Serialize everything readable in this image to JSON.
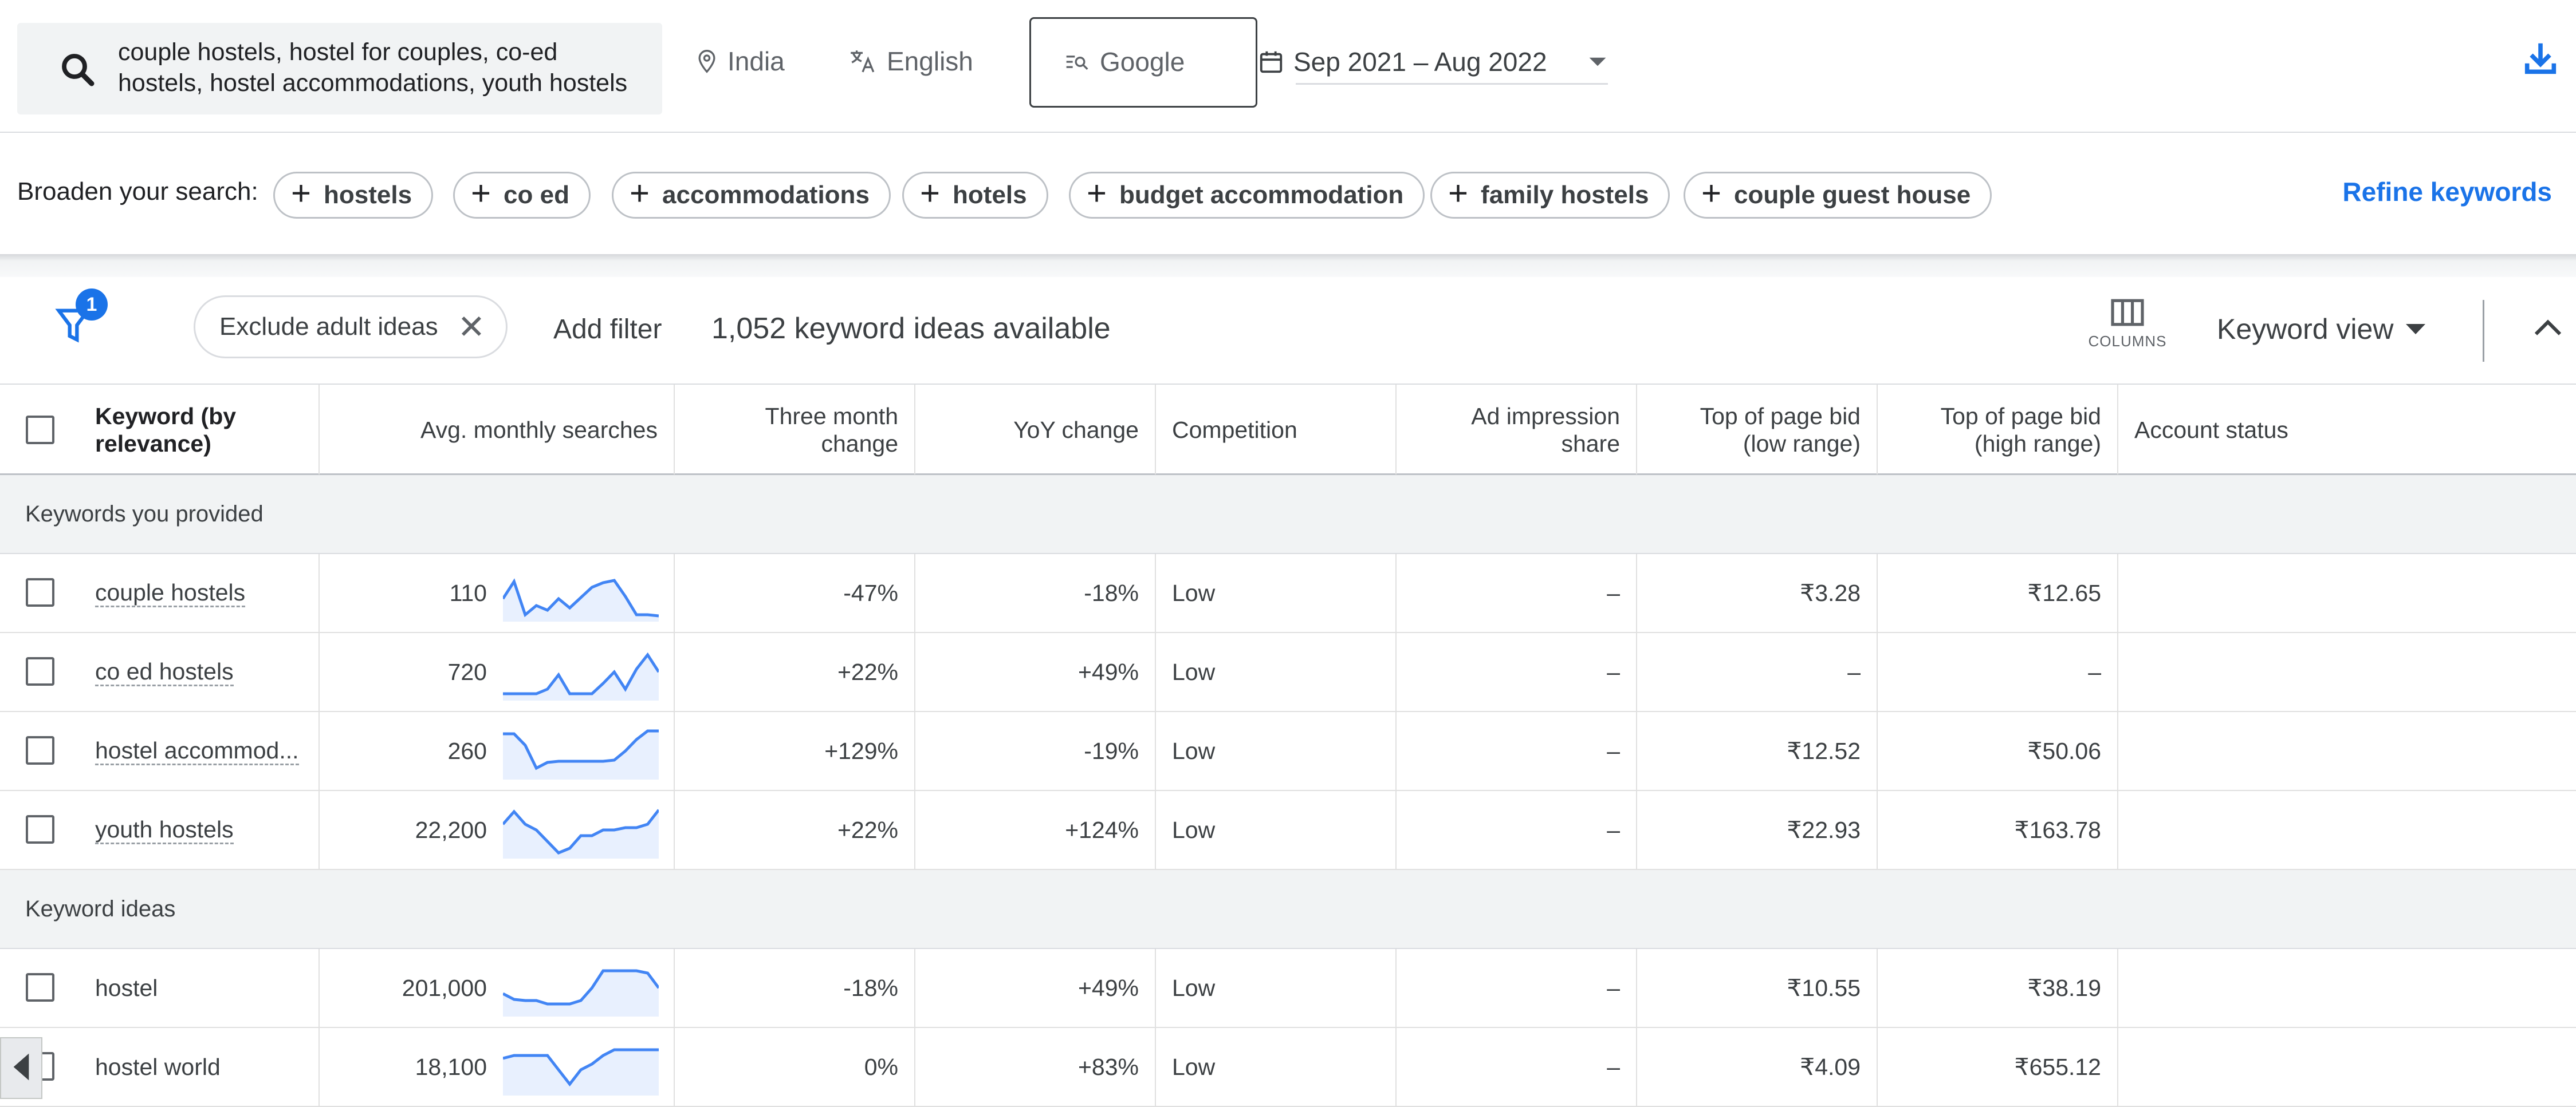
{
  "search": {
    "query_line1": "couple hostels, hostel for couples, co-ed",
    "query_line2": "hostels, hostel accommodations, youth hostels",
    "location": "India",
    "language": "English",
    "network": "Google",
    "date_range": "Sep 2021 – Aug 2022"
  },
  "broaden": {
    "label": "Broaden your search:",
    "chips": [
      "hostels",
      "co ed",
      "accommodations",
      "hotels",
      "budget accommodation",
      "family hostels",
      "couple guest house"
    ],
    "refine_label": "Refine keywords"
  },
  "filters": {
    "badge_count": "1",
    "exclude_chip": "Exclude adult ideas",
    "add_filter": "Add filter",
    "ideas_count": "1,052 keyword ideas available",
    "columns_label": "COLUMNS",
    "view_label": "Keyword view"
  },
  "table": {
    "headers": {
      "keyword_1": "Keyword (by",
      "keyword_2": "relevance)",
      "avg": "Avg. monthly searches",
      "three_1": "Three month",
      "three_2": "change",
      "yoy": "YoY change",
      "competition": "Competition",
      "ad_1": "Ad impression",
      "ad_2": "share",
      "low_1": "Top of page bid",
      "low_2": "(low range)",
      "high_1": "Top of page bid",
      "high_2": "(high range)",
      "status": "Account status"
    },
    "groups": [
      "Keywords you provided",
      "Keyword ideas"
    ],
    "rows": [
      {
        "keyword": "couple hostels",
        "avg": "110",
        "three_month": "-47%",
        "yoy": "-18%",
        "competition": "Low",
        "ad_share": "–",
        "bid_low": "₹3.28",
        "bid_high": "₹12.65"
      },
      {
        "keyword": "co ed hostels",
        "avg": "720",
        "three_month": "+22%",
        "yoy": "+49%",
        "competition": "Low",
        "ad_share": "–",
        "bid_low": "–",
        "bid_high": "–"
      },
      {
        "keyword": "hostel accommod...",
        "avg": "260",
        "three_month": "+129%",
        "yoy": "-19%",
        "competition": "Low",
        "ad_share": "–",
        "bid_low": "₹12.52",
        "bid_high": "₹50.06"
      },
      {
        "keyword": "youth hostels",
        "avg": "22,200",
        "three_month": "+22%",
        "yoy": "+124%",
        "competition": "Low",
        "ad_share": "–",
        "bid_low": "₹22.93",
        "bid_high": "₹163.78"
      },
      {
        "keyword": "hostel",
        "avg": "201,000",
        "three_month": "-18%",
        "yoy": "+49%",
        "competition": "Low",
        "ad_share": "–",
        "bid_low": "₹10.55",
        "bid_high": "₹38.19"
      },
      {
        "keyword": "hostel world",
        "avg": "18,100",
        "three_month": "0%",
        "yoy": "+83%",
        "competition": "Low",
        "ad_share": "–",
        "bid_low": "₹4.09",
        "bid_high": "₹655.12"
      }
    ]
  },
  "colors": {
    "accent": "#1a73e8",
    "spark_line": "#4285f4",
    "spark_fill": "#e8f0fe",
    "group_bg": "#f1f3f4"
  }
}
